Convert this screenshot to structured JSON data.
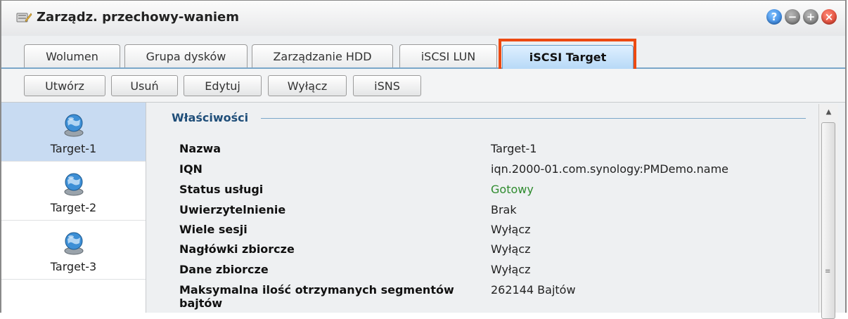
{
  "window": {
    "title": "Zarządz. przechowy-waniem",
    "app_icon": "storage-manager-icon",
    "controls": {
      "help": "?",
      "minimize": "−",
      "maximize": "+",
      "close": "×"
    }
  },
  "tabs": [
    {
      "label": "Wolumen",
      "active": false
    },
    {
      "label": "Grupa dysków",
      "active": false
    },
    {
      "label": "Zarządzanie HDD",
      "active": false
    },
    {
      "label": "iSCSI LUN",
      "active": false
    },
    {
      "label": "iSCSI Target",
      "active": true
    }
  ],
  "toolbar": {
    "create": "Utwórz",
    "delete": "Usuń",
    "edit": "Edytuj",
    "disable": "Wyłącz",
    "isns": "iSNS"
  },
  "sidebar": {
    "items": [
      {
        "label": "Target-1",
        "icon": "globe-disk-icon",
        "selected": true
      },
      {
        "label": "Target-2",
        "icon": "globe-disk-icon",
        "selected": false
      },
      {
        "label": "Target-3",
        "icon": "globe-disk-icon",
        "selected": false
      }
    ]
  },
  "properties": {
    "title": "Właściwości",
    "rows": [
      {
        "label": "Nazwa",
        "value": "Target-1"
      },
      {
        "label": "IQN",
        "value": "iqn.2000-01.com.synology:PMDemo.name"
      },
      {
        "label": "Status usługi",
        "value": "Gotowy"
      },
      {
        "label": "Uwierzytelnienie",
        "value": "Brak"
      },
      {
        "label": "Wiele sesji",
        "value": "Wyłącz"
      },
      {
        "label": "Nagłówki zbiorcze",
        "value": "Wyłącz"
      },
      {
        "label": "Dane zbiorcze",
        "value": "Wyłącz"
      },
      {
        "label": "Maksymalna ilość otrzymanych segmentów bajtów",
        "value": "262144 Bajtów"
      }
    ]
  },
  "colors": {
    "accent": "#7aa7c9",
    "highlight": "#ec4a12",
    "status_ok": "#2e8b2e",
    "selected_bg": "#c8dbf2"
  }
}
